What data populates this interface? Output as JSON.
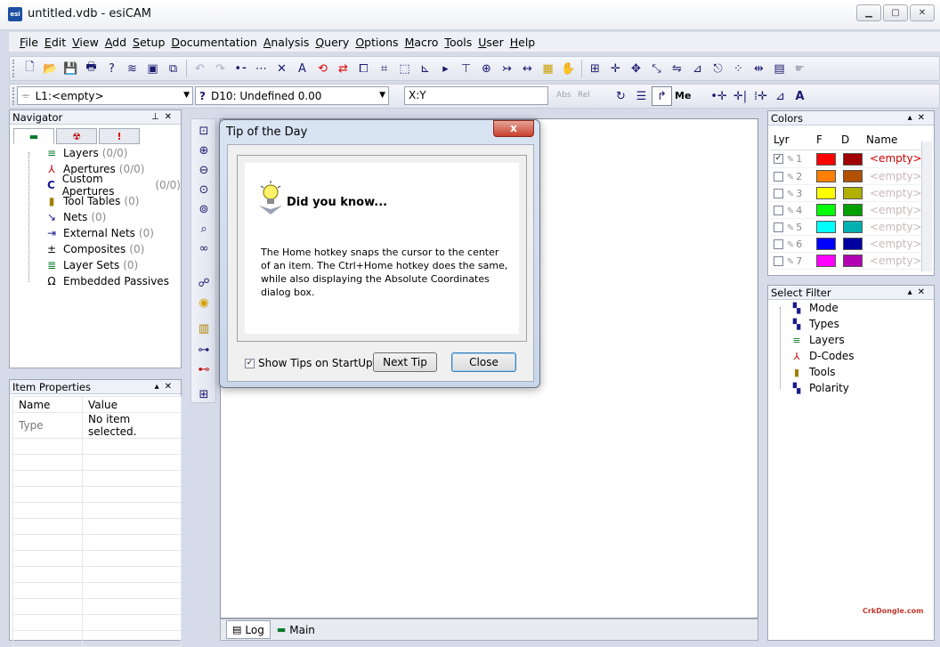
{
  "window": {
    "title": "untitled.vdb - esiCAM",
    "app_icon_text": "esi",
    "minimize": "▁",
    "maximize": "▢",
    "close": "✕"
  },
  "menu": [
    "File",
    "Edit",
    "View",
    "Add",
    "Setup",
    "Documentation",
    "Analysis",
    "Query",
    "Options",
    "Macro",
    "Tools",
    "User",
    "Help"
  ],
  "toolbar2": {
    "layer_combo": "L1:<empty>",
    "dcode_combo": "D10: Undefined 0.00",
    "coord_field": "X:Y",
    "abs_label": "Abs",
    "rel_label": "Rel",
    "me_label": "Me"
  },
  "navigator": {
    "title": "Navigator",
    "items": [
      {
        "label": "Layers",
        "count": "(0/0)",
        "icon": "layers-icon"
      },
      {
        "label": "Apertures",
        "count": "(0/0)",
        "icon": "apertures-icon"
      },
      {
        "label": "Custom Apertures",
        "count": "(0/0)",
        "icon": "custom-apertures-icon"
      },
      {
        "label": "Tool Tables",
        "count": "(0)",
        "icon": "tool-tables-icon"
      },
      {
        "label": "Nets",
        "count": "(0)",
        "icon": "nets-icon"
      },
      {
        "label": "External Nets",
        "count": "(0)",
        "icon": "external-nets-icon"
      },
      {
        "label": "Composites",
        "count": "(0)",
        "icon": "composites-icon"
      },
      {
        "label": "Layer Sets",
        "count": "(0)",
        "icon": "layer-sets-icon"
      },
      {
        "label": "Embedded Passives",
        "count": "",
        "icon": "omega-icon"
      }
    ]
  },
  "item_properties": {
    "title": "Item Properties",
    "col_name": "Name",
    "col_value": "Value",
    "row_name": "Type",
    "row_value": "No item selected."
  },
  "colors": {
    "title": "Colors",
    "headers": {
      "lyr": "Lyr",
      "f": "F",
      "d": "D",
      "name": "Name"
    },
    "rows": [
      {
        "num": "1",
        "f": "#ff0000",
        "d": "#a00000",
        "name": "<empty>",
        "checked": true
      },
      {
        "num": "2",
        "f": "#ff8000",
        "d": "#b05000",
        "name": "<empty>",
        "checked": false
      },
      {
        "num": "3",
        "f": "#ffff00",
        "d": "#b0b000",
        "name": "<empty>",
        "checked": false
      },
      {
        "num": "4",
        "f": "#00ff00",
        "d": "#00a000",
        "name": "<empty>",
        "checked": false
      },
      {
        "num": "5",
        "f": "#00ffff",
        "d": "#00b0b0",
        "name": "<empty>",
        "checked": false
      },
      {
        "num": "6",
        "f": "#0000ff",
        "d": "#0000a0",
        "name": "<empty>",
        "checked": false
      },
      {
        "num": "7",
        "f": "#ff00ff",
        "d": "#b000b0",
        "name": "<empty>",
        "checked": false
      }
    ]
  },
  "select_filter": {
    "title": "Select Filter",
    "items": [
      "Mode",
      "Types",
      "Layers",
      "D-Codes",
      "Tools",
      "Polarity"
    ]
  },
  "bottom_tabs": [
    {
      "label": "Log",
      "active": true
    },
    {
      "label": "Main",
      "active": false
    }
  ],
  "dialog": {
    "title": "Tip of the Day",
    "close": "x",
    "heading": "Did you know...",
    "tip_text": "The Home hotkey snaps the cursor to the center of an item. The Ctrl+Home hotkey does the same, while also displaying the Absolute Coordinates dialog box.",
    "show_tips": "Show Tips on StartUp",
    "next_tip": "Next Tip",
    "close_button": "Close"
  },
  "watermark": "CrkDongle.com"
}
